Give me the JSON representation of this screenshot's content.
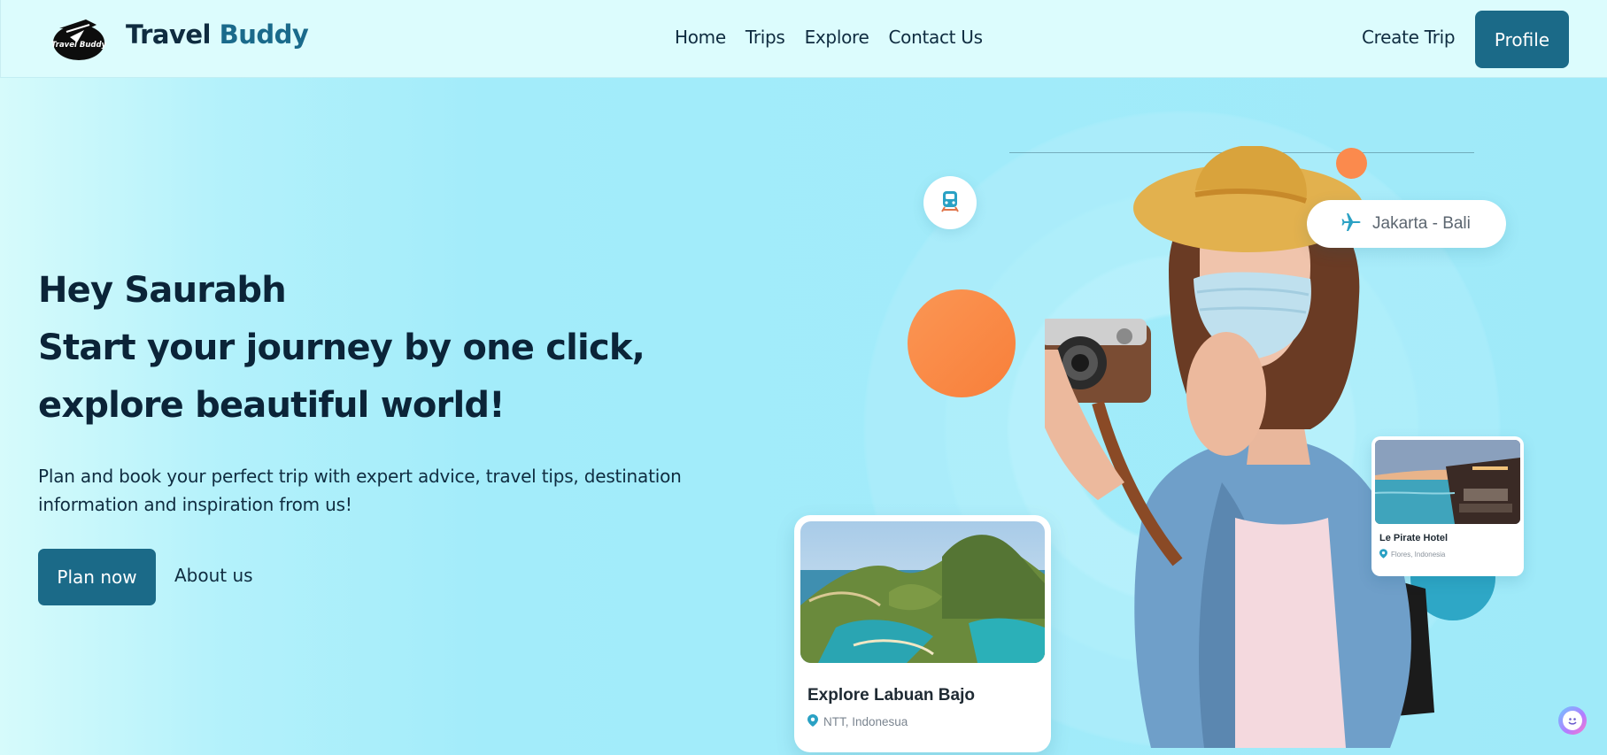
{
  "navbar": {
    "logo_icon": "travel-buddy-logo",
    "logo_text": "Travel Buddy",
    "brand_first": "Travel",
    "brand_second": "Buddy",
    "links": [
      "Home",
      "Trips",
      "Explore",
      "Contact Us"
    ],
    "create_trip": "Create Trip",
    "profile": "Profile"
  },
  "hero": {
    "greeting": "Hey Saurabh",
    "title_line_1": "Start your journey by one click,",
    "title_line_2": "explore beautiful world!",
    "description": "Plan and book your perfect trip with expert advice, travel tips, destination information and inspiration from us!",
    "plan_button": "Plan now",
    "about_link": "About us"
  },
  "illustration": {
    "train_icon": "train-icon",
    "route_icon": "airplane-icon",
    "route": "Jakarta - Bali",
    "card_main": {
      "title": "Explore Labuan Bajo",
      "location": "NTT, Indonesua",
      "location_icon": "map-pin-icon"
    },
    "card_small": {
      "title": "Le Pirate Hotel",
      "location": "Flores, Indonesia",
      "location_icon": "map-pin-icon"
    }
  },
  "colors": {
    "primary": "#1b6a88",
    "accent_orange": "#fb8a4d",
    "teal": "#2ea7c6",
    "text_dark": "#0b2438"
  },
  "chat_widget_icon": "chat-assistant-icon"
}
